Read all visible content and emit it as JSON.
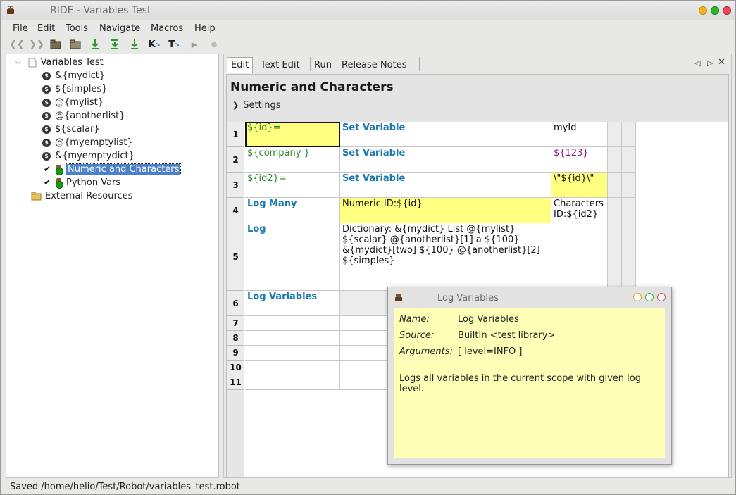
{
  "window": {
    "title": "RIDE - Variables Test",
    "controls": {
      "minimize_color": "#f5b31f",
      "maximize_color": "#2ab52a",
      "close_color": "#e8485a"
    }
  },
  "menu": [
    "File",
    "Edit",
    "Tools",
    "Navigate",
    "Macros",
    "Help"
  ],
  "toolbar": {
    "icons": [
      "back-icon",
      "forward-icon",
      "open-icon",
      "open-directory-icon",
      "new-test-icon",
      "new-keyword-icon",
      "save-icon",
      "keyword-search-icon",
      "text-search-icon",
      "run-icon",
      "stop-icon"
    ],
    "k_label": "K",
    "t_label": "T"
  },
  "tree": {
    "root": "Variables Test",
    "variables": [
      "&{mydict}",
      "${simples}",
      "@{mylist}",
      "@{anotherlist}",
      "${scalar}",
      "@{myemptylist}",
      "&{myemptydict}"
    ],
    "tests": [
      {
        "label": "Numeric and Characters",
        "selected": true
      },
      {
        "label": "Python Vars",
        "selected": false
      }
    ],
    "external": "External Resources"
  },
  "tabs": [
    {
      "label": "Edit",
      "active": true
    },
    {
      "label": "Text Edit",
      "active": false
    },
    {
      "label": "Run",
      "active": false
    },
    {
      "label": "Release Notes",
      "active": false
    }
  ],
  "editor": {
    "heading": "Numeric and Characters",
    "settings_label": "Settings"
  },
  "grid": {
    "rows": [
      {
        "num": "1",
        "c1": "${id}=",
        "c2": "Set Variable",
        "c3": "myId"
      },
      {
        "num": "2",
        "c1": "${company }",
        "c2": "Set Variable",
        "c3": "${123}"
      },
      {
        "num": "3",
        "c1": "${id2}=",
        "c2": "Set Variable",
        "c3": "\\\"${id}\\\""
      },
      {
        "num": "4",
        "c1": "Log Many",
        "c2": "Numeric ID:${id}",
        "c3a": "Characters",
        "c3b": "ID:${id2}"
      },
      {
        "num": "5",
        "c1": "Log",
        "c2_lines": [
          "Dictionary: &{mydict} List @{mylist}",
          "${scalar} @{anotherlist}[1] a ${100}",
          "&{mydict}[two] ${100} @{anotherlist}[2]",
          "${simples}"
        ],
        "c3": ""
      },
      {
        "num": "6",
        "c1": "Log Variables",
        "c2": "",
        "c3": ""
      },
      {
        "num": "7"
      },
      {
        "num": "8"
      },
      {
        "num": "9"
      },
      {
        "num": "10"
      },
      {
        "num": "11"
      }
    ]
  },
  "popup": {
    "title": "Log Variables",
    "name_label": "Name:",
    "name_value": "Log Variables",
    "source_label": "Source:",
    "source_value": "BuiltIn <test library>",
    "args_label": "Arguments:",
    "args_value": "[ level=INFO ]",
    "doc_lines": [
      "Logs all variables in the current scope with given log",
      "level."
    ]
  },
  "status": "Saved /home/helio/Test/Robot/variables_test.robot"
}
